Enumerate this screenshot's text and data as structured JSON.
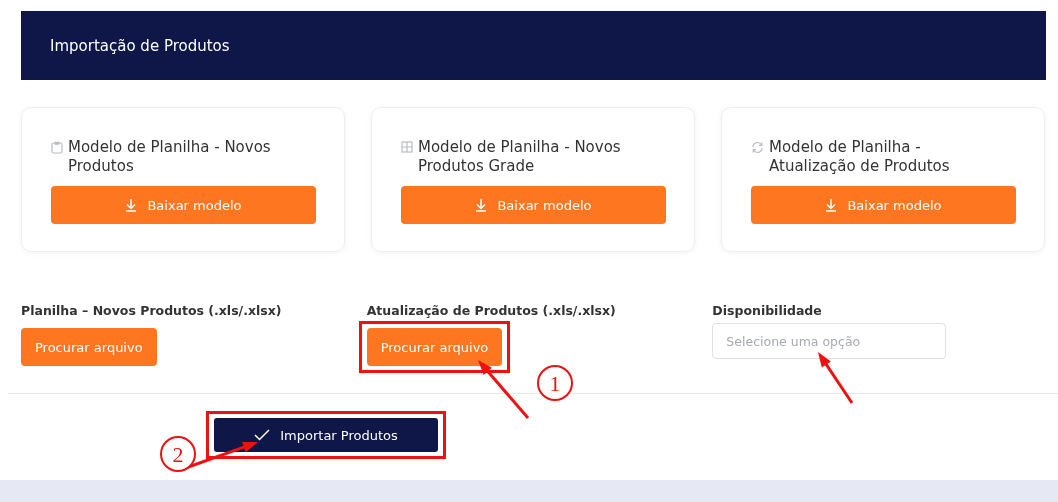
{
  "header": {
    "title": "Importação de Produtos"
  },
  "cards": [
    {
      "title": "Modelo de Planilha - Novos Produtos",
      "button": "Baixar modelo"
    },
    {
      "title": "Modelo de Planilha - Novos Produtos Grade",
      "button": "Baixar modelo"
    },
    {
      "title": "Modelo de Planilha - Atualização de Produtos",
      "button": "Baixar modelo"
    }
  ],
  "fields": [
    {
      "kind": "file",
      "label": "Planilha – Novos Produtos (.xls/.xlsx)",
      "button": "Procurar arquivo",
      "highlighted": false
    },
    {
      "kind": "file",
      "label": "Atualização de Produtos (.xls/.xlsx)",
      "button": "Procurar arquivo",
      "highlighted": true
    },
    {
      "kind": "select",
      "label": "Disponibilidade",
      "placeholder": "Selecione uma opção"
    }
  ],
  "submit": {
    "label": "Importar Produtos",
    "highlighted": true
  },
  "annotations": [
    {
      "kind": "numbered",
      "number": "1"
    },
    {
      "kind": "arrow"
    },
    {
      "kind": "numbered",
      "number": "2"
    }
  ]
}
